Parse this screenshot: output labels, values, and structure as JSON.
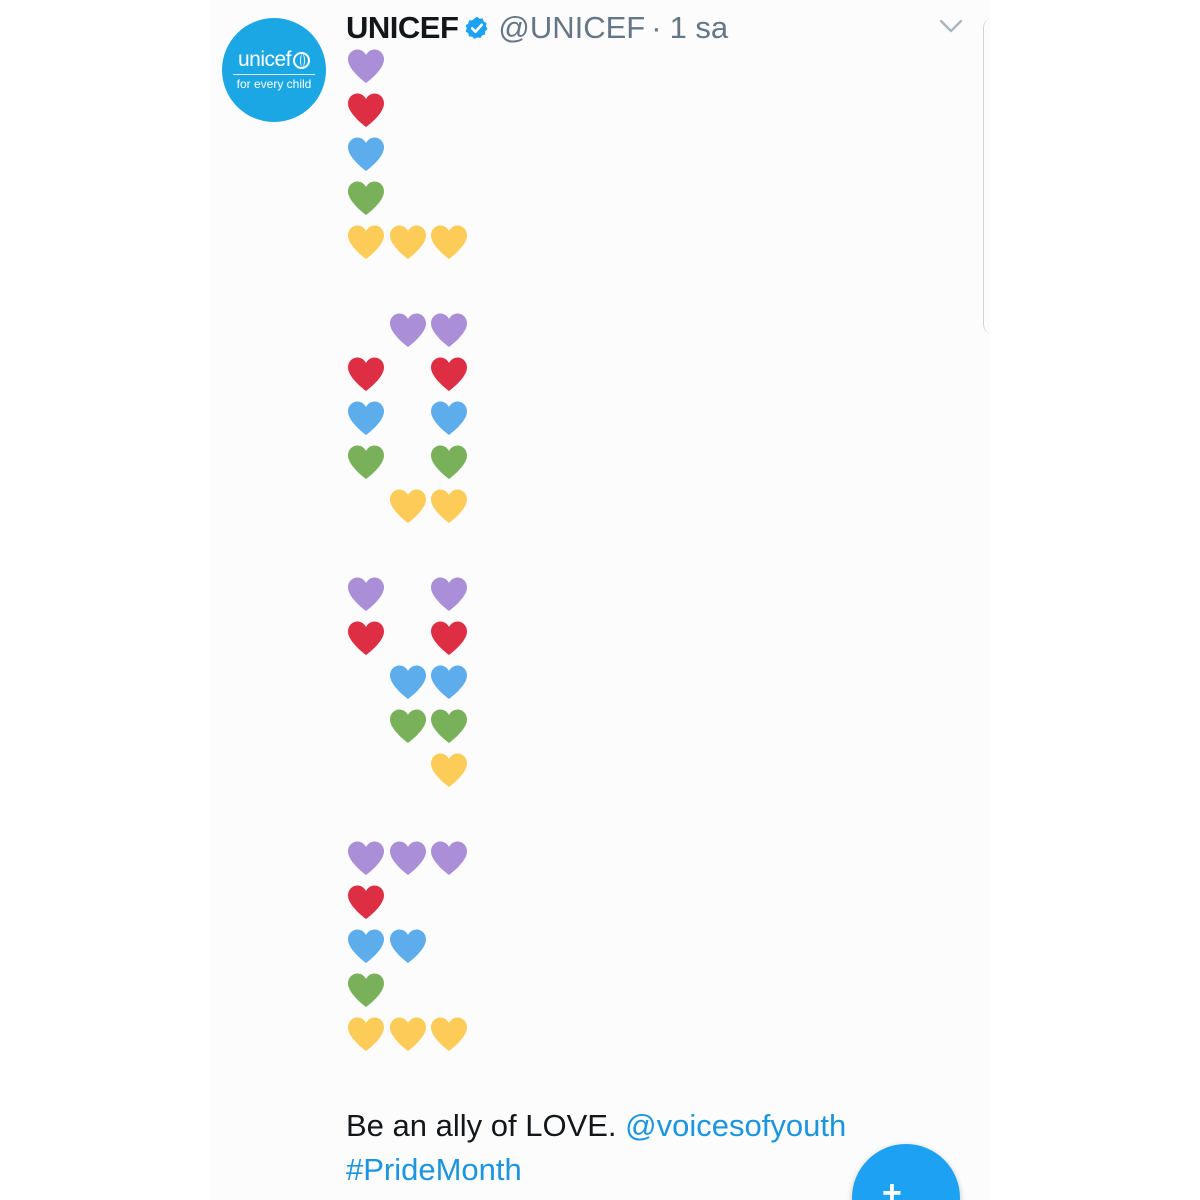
{
  "tweet": {
    "avatar": {
      "brand": "unicef",
      "tagline": "for every child",
      "bg_color": "#1aa7e4"
    },
    "display_name": "UNICEF",
    "verified_icon": "verified-badge-icon",
    "handle": "@UNICEF",
    "separator": "·",
    "time": "1 sa",
    "menu_icon": "chevron-down-icon",
    "text": "Be an ally of LOVE.",
    "mention": "@voicesofyouth",
    "hashtag": "#PrideMonth"
  },
  "heart_colors": {
    "purple": "#ab8ed8",
    "red": "#dd2e44",
    "blue": "#5dadec",
    "green": "#78b159",
    "yellow": "#fdcb58"
  },
  "heart_art": [
    [
      "purple"
    ],
    [
      "red"
    ],
    [
      "blue"
    ],
    [
      "green"
    ],
    [
      "yellow",
      "yellow",
      "yellow"
    ],
    [],
    [
      null,
      "purple",
      "purple"
    ],
    [
      "red",
      null,
      "red"
    ],
    [
      "blue",
      null,
      "blue"
    ],
    [
      "green",
      null,
      "green"
    ],
    [
      null,
      "yellow",
      "yellow"
    ],
    [],
    [
      "purple",
      null,
      "purple"
    ],
    [
      "red",
      null,
      "red"
    ],
    [
      null,
      "blue",
      "blue"
    ],
    [
      null,
      "green",
      "green"
    ],
    [
      null,
      null,
      "yellow"
    ],
    [],
    [
      "purple",
      "purple",
      "purple"
    ],
    [
      "red"
    ],
    [
      "blue",
      "blue"
    ],
    [
      "green"
    ],
    [
      "yellow",
      "yellow",
      "yellow"
    ]
  ],
  "compose_button": {
    "icon": "compose-tweet-icon",
    "glyph": "+",
    "color": "#1da1f2"
  }
}
